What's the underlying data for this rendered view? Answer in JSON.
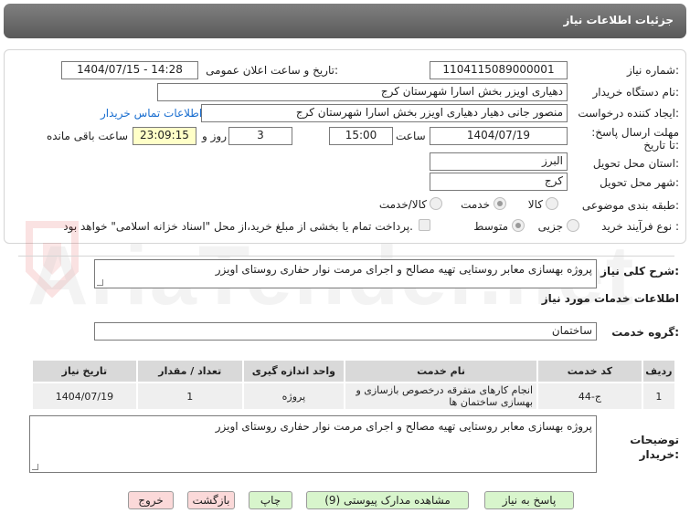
{
  "header": {
    "title": "جزئیات اطلاعات نیاز"
  },
  "form": {
    "need_number_label": "شماره نیاز:",
    "need_number": "1104115089000001",
    "announce_label": "تاریخ و ساعت اعلان عمومی:",
    "announce_value": "1404/07/15 - 14:28",
    "buyer_org_label": "نام دستگاه خریدار:",
    "buyer_org": "دهیاری اویزر بخش اسارا شهرستان کرج",
    "creator_label": "ایجاد کننده درخواست:",
    "creator": "منصور جانی دهیار دهیاری اویزر بخش اسارا شهرستان کرج",
    "contact_link": "اطلاعات تماس خریدار",
    "deadline_label": "مهلت ارسال پاسخ: تا تاریخ:",
    "deadline_date": "1404/07/19",
    "time_label": "ساعت",
    "deadline_time": "15:00",
    "days_value": "3",
    "days_label": "روز و",
    "remaining_time": "23:09:15",
    "remaining_label": "ساعت باقی مانده",
    "province_label": "استان محل تحویل:",
    "province": "البرز",
    "city_label": "شهر محل تحویل:",
    "city": "کرج",
    "category_label": "طبقه بندی موضوعی:",
    "category_options": [
      "کالا",
      "خدمت",
      "کالا/خدمت"
    ],
    "purchase_type_label": "نوع فرآیند خرید :",
    "purchase_options": [
      "جزیی",
      "متوسط"
    ],
    "payment_note": "پرداخت تمام یا بخشی از مبلغ خرید،از محل \"اسناد خزانه اسلامی\" خواهد بود."
  },
  "description": {
    "label": "شرح کلی نیاز:",
    "text": "پروژه بهسازی معابر روستایی تهیه مصالح و اجرای مرمت نوار حفاری روستای اویزر"
  },
  "services_section": {
    "title": "اطلاعات خدمات مورد نیاز",
    "group_label": "گروه خدمت:",
    "group_value": "ساختمان"
  },
  "table": {
    "headers": [
      "ردیف",
      "کد خدمت",
      "نام خدمت",
      "واحد اندازه گیری",
      "تعداد / مقدار",
      "تاریخ نیاز"
    ],
    "rows": [
      [
        "1",
        "ج-44",
        "انجام کارهای متفرقه درخصوص بازسازی و بهسازی ساختمان ها",
        "پروژه",
        "1",
        "1404/07/19"
      ]
    ]
  },
  "buyer_notes": {
    "label": "توضیحات خریدار:",
    "text": "پروژه بهسازی معابر روستایی تهیه مصالح و اجرای مرمت نوار حفاری روستای اویزر"
  },
  "buttons": {
    "reply": "پاسخ به نیاز",
    "view_docs": "مشاهده مدارک پیوستی (9)",
    "print": "چاپ",
    "back": "بازگشت",
    "exit": "خروج"
  },
  "watermark": "AriaTender.net",
  "colors": {
    "header": "#6b6b6b",
    "link": "#1b6fd0",
    "highlight": "#ffffc8",
    "green_button": "#d8f5cc",
    "pink_button": "#fbd9d9"
  }
}
